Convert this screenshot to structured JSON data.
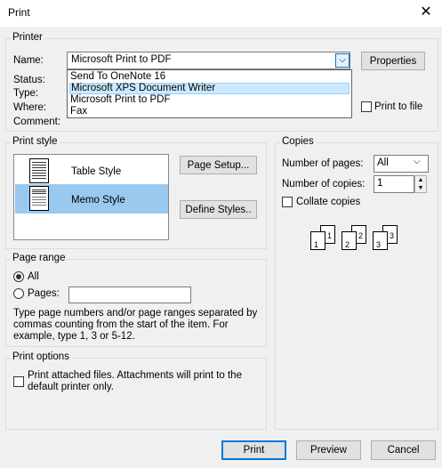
{
  "window": {
    "title": "Print"
  },
  "printer": {
    "legend": "Printer",
    "name_label": "Name:",
    "name_value": "Microsoft Print to PDF",
    "status_label": "Status:",
    "type_label": "Type:",
    "where_label": "Where:",
    "comment_label": "Comment:",
    "properties_label": "Properties",
    "print_to_file_label": "Print to file",
    "dropdown_options": [
      "Send To OneNote 16",
      "Microsoft XPS Document Writer",
      "Microsoft Print to PDF",
      "Fax"
    ],
    "highlighted_option": "Microsoft XPS Document Writer"
  },
  "print_style": {
    "legend": "Print style",
    "styles": [
      "Table Style",
      "Memo Style"
    ],
    "selected": "Memo Style",
    "page_setup_label": "Page Setup...",
    "define_styles_label": "Define Styles.."
  },
  "copies": {
    "legend": "Copies",
    "num_pages_label": "Number of pages:",
    "num_pages_value": "All",
    "num_copies_label": "Number of copies:",
    "num_copies_value": "1",
    "collate_label": "Collate copies",
    "collate_checked": false,
    "collate_pages": [
      "1",
      "1",
      "2",
      "2",
      "3",
      "3"
    ]
  },
  "page_range": {
    "legend": "Page range",
    "all_label": "All",
    "pages_label": "Pages:",
    "pages_value": "",
    "selected": "All",
    "help_text_1": "Type page numbers and/or page ranges separated by",
    "help_text_2": "commas counting from the start of the item.  For",
    "help_text_3": "example, type 1, 3 or 5-12."
  },
  "print_options": {
    "legend": "Print options",
    "attach_label_1": "Print attached files.  Attachments will print to the",
    "attach_label_2": "default printer only.",
    "attach_checked": false
  },
  "footer": {
    "print_label": "Print",
    "preview_label": "Preview",
    "cancel_label": "Cancel"
  },
  "colors": {
    "accent": "#0078d7",
    "selection": "#cce8ff",
    "style_selection": "#99c9ef"
  }
}
